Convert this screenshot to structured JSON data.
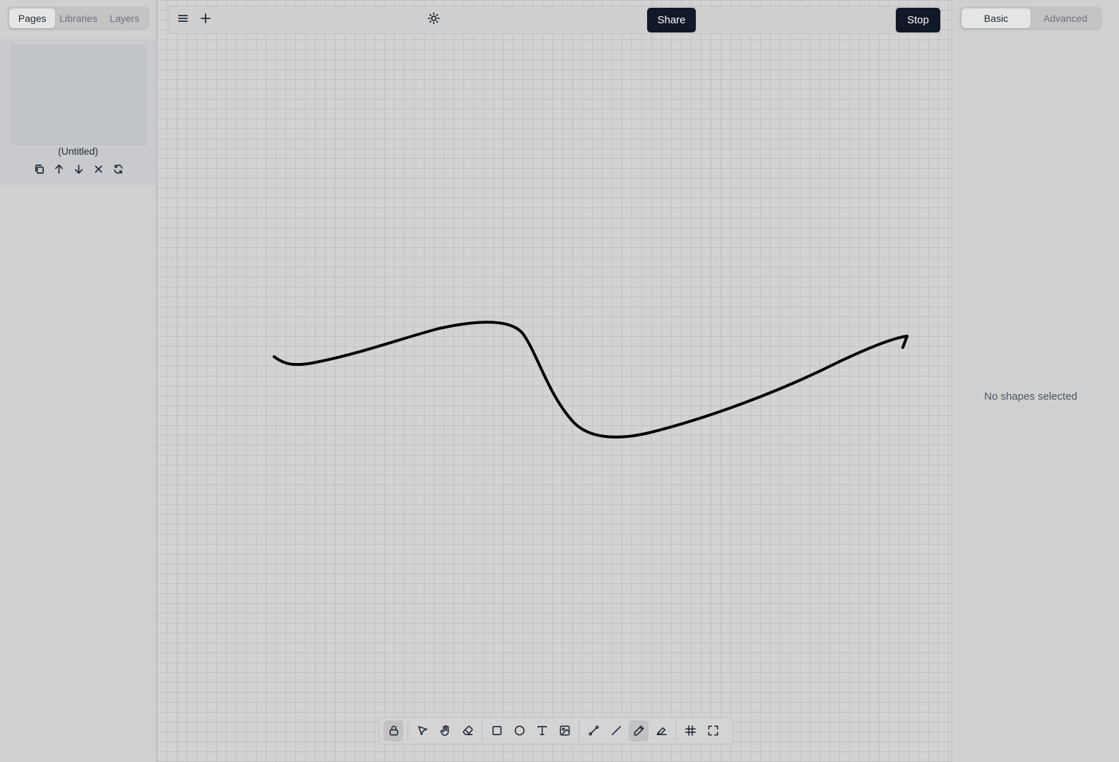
{
  "left_sidebar": {
    "tabs": [
      {
        "label": "Pages",
        "active": true
      },
      {
        "label": "Libraries",
        "active": false
      },
      {
        "label": "Layers",
        "active": false
      }
    ],
    "page": {
      "name": "(Untitled)",
      "actions": [
        "duplicate-icon",
        "move-up-icon",
        "move-down-icon",
        "delete-icon",
        "reset-icon"
      ]
    }
  },
  "topbar": {
    "menu_icon": "menu-icon",
    "add_icon": "plus-icon",
    "theme_icon": "sun-icon",
    "share_label": "Share",
    "stop_label": "Stop"
  },
  "toolbar": {
    "tools": [
      {
        "icon": "lock-icon",
        "active": true
      },
      {
        "icon": "select-icon",
        "active": false
      },
      {
        "icon": "hand-icon",
        "active": false
      },
      {
        "icon": "eraser-icon",
        "active": false
      },
      {
        "icon": "rectangle-icon",
        "active": false
      },
      {
        "icon": "ellipse-icon",
        "active": false
      },
      {
        "icon": "text-icon",
        "active": false
      },
      {
        "icon": "image-icon",
        "active": false
      },
      {
        "icon": "connector-icon",
        "active": false
      },
      {
        "icon": "line-icon",
        "active": false
      },
      {
        "icon": "pencil-icon",
        "active": true
      },
      {
        "icon": "highlighter-icon",
        "active": false
      },
      {
        "icon": "grid-icon",
        "active": false
      },
      {
        "icon": "fullscreen-icon",
        "active": false
      }
    ]
  },
  "right_panel": {
    "tabs": [
      {
        "label": "Basic",
        "active": true
      },
      {
        "label": "Advanced",
        "active": false
      }
    ],
    "empty_message": "No shapes selected"
  },
  "colors": {
    "stroke": "#000000",
    "dark_button": "#111827",
    "background": "#d3d3d3"
  }
}
